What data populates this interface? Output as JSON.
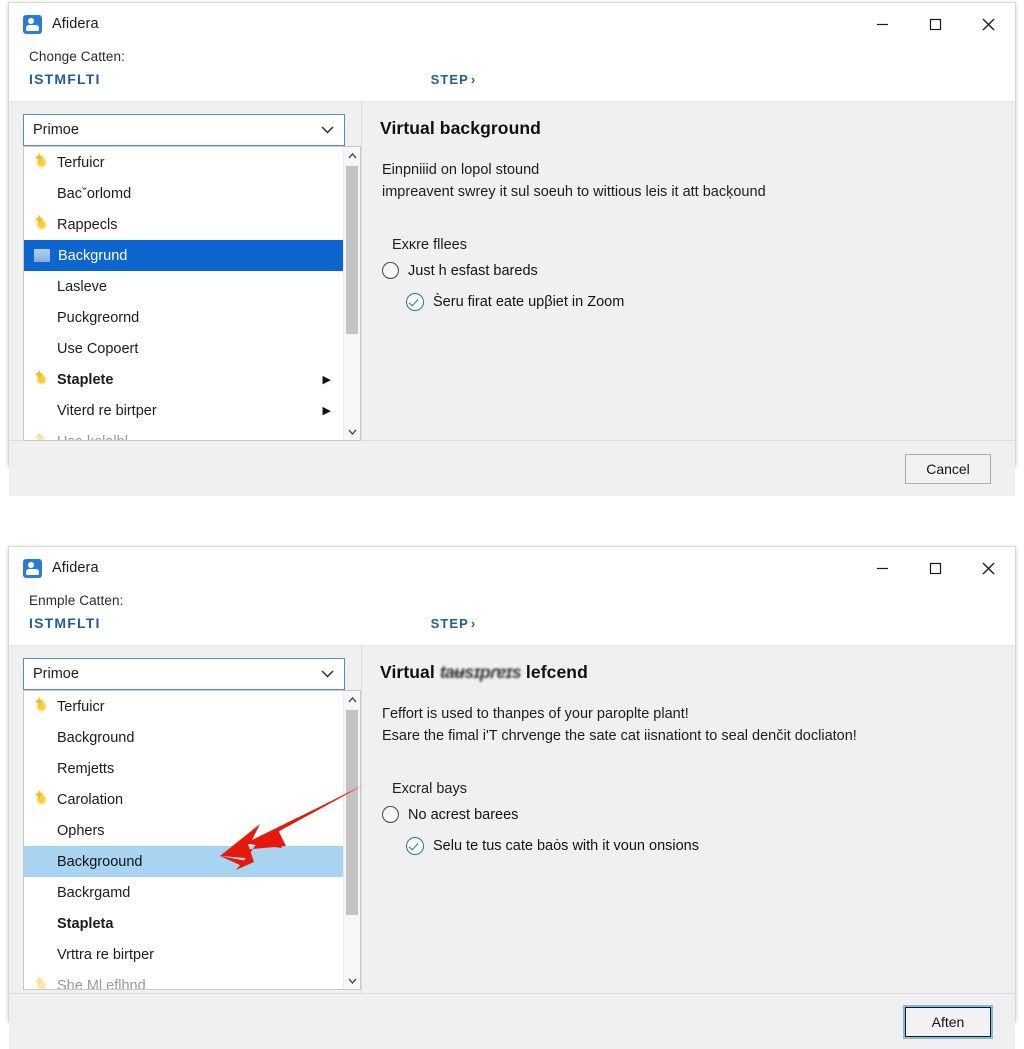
{
  "window1": {
    "titlebar": {
      "app_icon": "contact-card-icon",
      "title": "Afidera",
      "minimize": "minimize-icon",
      "maximize": "maximize-icon",
      "close": "close-icon"
    },
    "header": {
      "subtitle": "Chonge Catten:",
      "code": "ISTMFLTI",
      "step": "STEP",
      "step_chevron": "›"
    },
    "combobox": {
      "value": "Primoe",
      "chevron": "chevron-down-icon"
    },
    "dropdown": {
      "items": [
        {
          "label": "Terfuicr",
          "icon": "star-icon",
          "selected": false,
          "bold": false,
          "submenu": false
        },
        {
          "label": "Bacˇorlomd",
          "icon": "none",
          "selected": false,
          "bold": false,
          "submenu": false
        },
        {
          "label": "Rappecls",
          "icon": "star-icon",
          "selected": false,
          "bold": false,
          "submenu": false
        },
        {
          "label": "Backgrund",
          "icon": "image-icon",
          "selected": true,
          "bold": false,
          "submenu": false
        },
        {
          "label": "Lasleve",
          "icon": "none",
          "selected": false,
          "bold": false,
          "submenu": false
        },
        {
          "label": "Puckgreornd",
          "icon": "none",
          "selected": false,
          "bold": false,
          "submenu": false
        },
        {
          "label": "Use Copoert",
          "icon": "none",
          "selected": false,
          "bold": false,
          "submenu": false
        },
        {
          "label": "Staplete",
          "icon": "star-icon",
          "selected": false,
          "bold": true,
          "submenu": true
        },
        {
          "label": "Viterd re birtper",
          "icon": "none",
          "selected": false,
          "bold": false,
          "submenu": true
        },
        {
          "label": "Use kelalbl",
          "icon": "star-icon",
          "selected": false,
          "bold": false,
          "submenu": false
        }
      ],
      "scroll_up": "scroll-up-arrow",
      "scroll_down": "scroll-down-arrow",
      "submenu_arrow": "▶"
    },
    "panel": {
      "title": "Virtual background",
      "description_line1": "Einpniiid on lopol stound",
      "description_line2": "impreavent swrey it sul soeuh to wittious leis it att bacķound",
      "group_label": "Exĸre fllees",
      "radio_label": "Just h esfast bareds",
      "checkbox_label": "S̀eru ﬁrat eate upβiet in Zoom"
    },
    "footer": {
      "button": "Cancel",
      "focused": false
    }
  },
  "window2": {
    "titlebar": {
      "app_icon": "contact-card-icon",
      "title": "Afidera",
      "minimize": "minimize-icon",
      "maximize": "maximize-icon",
      "close": "close-icon"
    },
    "header": {
      "subtitle": "Enmple Catten:",
      "code": "ISTMFLTI",
      "step": "STEP",
      "step_chevron": "›"
    },
    "combobox": {
      "value": "Primoe",
      "chevron": "chevron-down-icon"
    },
    "dropdown": {
      "items": [
        {
          "label": "Terfuicr",
          "icon": "star-icon",
          "selected": false,
          "bold": false,
          "submenu": false
        },
        {
          "label": "Background",
          "icon": "none",
          "selected": false,
          "bold": false,
          "submenu": false
        },
        {
          "label": "Remjetts",
          "icon": "none",
          "selected": false,
          "bold": false,
          "submenu": false
        },
        {
          "label": "Carolation",
          "icon": "star-icon",
          "selected": false,
          "bold": false,
          "submenu": false
        },
        {
          "label": "Ophers",
          "icon": "none",
          "selected": false,
          "bold": false,
          "submenu": false
        },
        {
          "label": "Backgroound",
          "icon": "none",
          "selected": true,
          "bold": false,
          "submenu": false
        },
        {
          "label": "Backrgamd",
          "icon": "none",
          "selected": false,
          "bold": false,
          "submenu": false
        },
        {
          "label": "Stapleta",
          "icon": "none",
          "selected": false,
          "bold": true,
          "submenu": false
        },
        {
          "label": "Vrttra re birtper",
          "icon": "none",
          "selected": false,
          "bold": false,
          "submenu": false
        },
        {
          "label": "She Ml eflhnd",
          "icon": "star-icon",
          "selected": false,
          "bold": false,
          "submenu": false
        }
      ],
      "scroll_up": "scroll-up-arrow",
      "scroll_down": "scroll-down-arrow",
      "submenu_arrow": "▶"
    },
    "panel": {
      "title_part1": "Virtual",
      "title_smudge": "taʉsɪpɾɐɪs",
      "title_part2": "lefcend",
      "description_line1": "Γeffort is used to thanpes of your paroplte plant!",
      "description_line2": "Esare the fimal i'T chrvenge the sate cat iisnationt to seal denčit docliaton!",
      "group_label": "Excral bays",
      "radio_label": "No acrest barees",
      "checkbox_label": "Selu te tus cate baȯs with it voun onsions"
    },
    "footer": {
      "button": "Aften",
      "focused": true
    },
    "annotation": {
      "arrow": "red-pointer-arrow",
      "color": "#e5190c"
    }
  }
}
